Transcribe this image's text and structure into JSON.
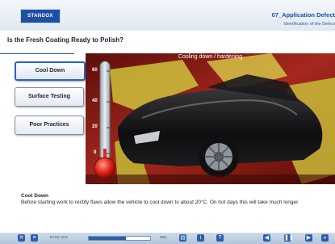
{
  "header": {
    "logo": "STANDOX",
    "title": "07_Application Defect",
    "subtitle": "Identification of the Defect"
  },
  "question": "Is the Fresh Coating Ready to Polish?",
  "sidebar": {
    "items": [
      {
        "label": "Cool Down",
        "active": true
      },
      {
        "label": "Surface Testing",
        "active": false
      },
      {
        "label": "Poor Practices",
        "active": false
      }
    ]
  },
  "stage": {
    "title": "Cooling down / hardening",
    "thermometer": {
      "ticks": [
        "60",
        "40",
        "20",
        "0"
      ],
      "level_fraction": 0.0
    }
  },
  "caption": {
    "title": "Cool Down",
    "text": "Before starting work to rectify flaws allow the vehicle to cool down to about 20°C. On hot days this will take much longer."
  },
  "footer": {
    "slide_counter": "PAGE 5/21",
    "progress_fraction": 0.6,
    "percent_text": "59%",
    "colors": {
      "bar": "#2d5ea8"
    }
  }
}
